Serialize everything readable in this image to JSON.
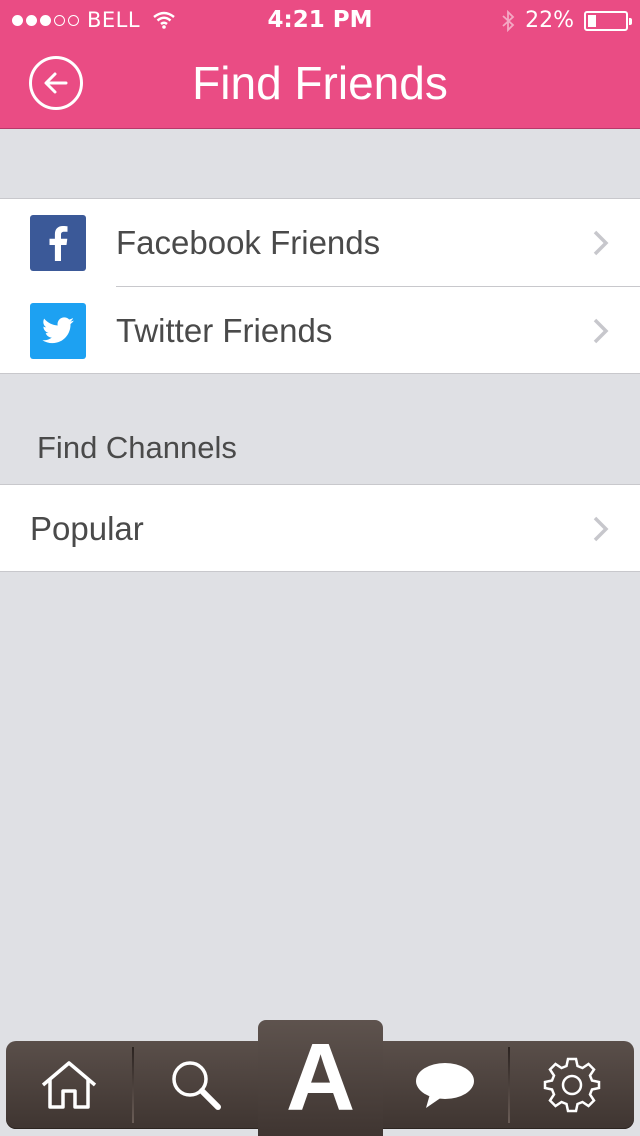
{
  "status_bar": {
    "carrier": "BELL",
    "time": "4:21 PM",
    "battery": "22%",
    "battery_level": 0.22,
    "signal_bars_filled": 3,
    "signal_bars_total": 5
  },
  "header": {
    "title": "Find Friends",
    "back_icon": "back-arrow-circle-icon",
    "color": "#ea4c84"
  },
  "friends": [
    {
      "label": "Facebook Friends",
      "icon": "facebook-icon",
      "color": "#3b5998"
    },
    {
      "label": "Twitter Friends",
      "icon": "twitter-icon",
      "color": "#1da1f2"
    }
  ],
  "channels": {
    "header": "Find Channels",
    "items": [
      {
        "label": "Popular"
      }
    ]
  },
  "tab_bar": {
    "tabs": [
      "home-icon",
      "search-icon",
      "app-logo-icon",
      "chat-bubble-icon",
      "settings-gear-icon"
    ],
    "center_label": "A"
  }
}
